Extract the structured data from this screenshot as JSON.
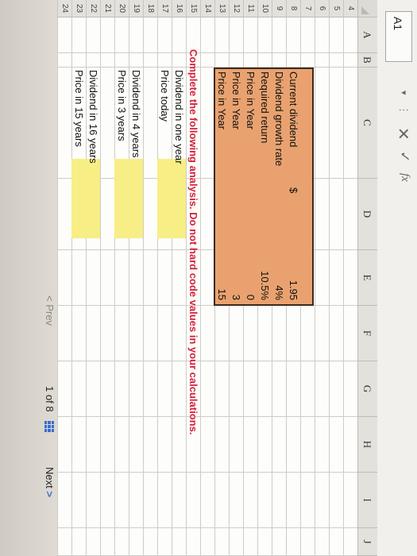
{
  "formula_bar": {
    "cell_ref": "A1",
    "dropdown": "▾",
    "more": "⋮",
    "cancel": "✕",
    "confirm": "✓",
    "fx": "fx"
  },
  "columns": [
    "A",
    "B",
    "C",
    "D",
    "E",
    "F",
    "G",
    "H",
    "I",
    "J"
  ],
  "rows": [
    "4",
    "5",
    "6",
    "7",
    "8",
    "9",
    "10",
    "11",
    "12",
    "13",
    "14",
    "15",
    "16",
    "17",
    "18",
    "19",
    "20",
    "21",
    "22",
    "23",
    "24"
  ],
  "inputs": {
    "current_dividend": {
      "label": "Current dividend",
      "currency": "$",
      "value": "1.95"
    },
    "dividend_growth_rate": {
      "label": "Dividend growth rate",
      "value": "4%"
    },
    "required_return": {
      "label": "Required return",
      "value": "10.5%"
    },
    "price_year_a": {
      "label": "Price in Year",
      "value": "0"
    },
    "price_year_b": {
      "label": "Price in Year",
      "value": "3"
    },
    "price_year_c": {
      "label": "Price in Year",
      "value": "15"
    }
  },
  "instruction": "Complete the following analysis. Do not hard code values in your calculations.",
  "analysis": [
    {
      "label": "Dividend in one year",
      "value": ""
    },
    {
      "label": "Price today",
      "value": ""
    },
    {
      "label": "Dividend in 4 years",
      "value": ""
    },
    {
      "label": "Price in 3 years",
      "value": ""
    },
    {
      "label": "Dividend in 16 years",
      "value": ""
    },
    {
      "label": "Price in 15 years",
      "value": ""
    }
  ],
  "pagination": {
    "prev_label": "Prev",
    "page_text": "1 of 8",
    "next_label": "Next",
    "prev_arrow": "<",
    "next_arrow": ">"
  }
}
